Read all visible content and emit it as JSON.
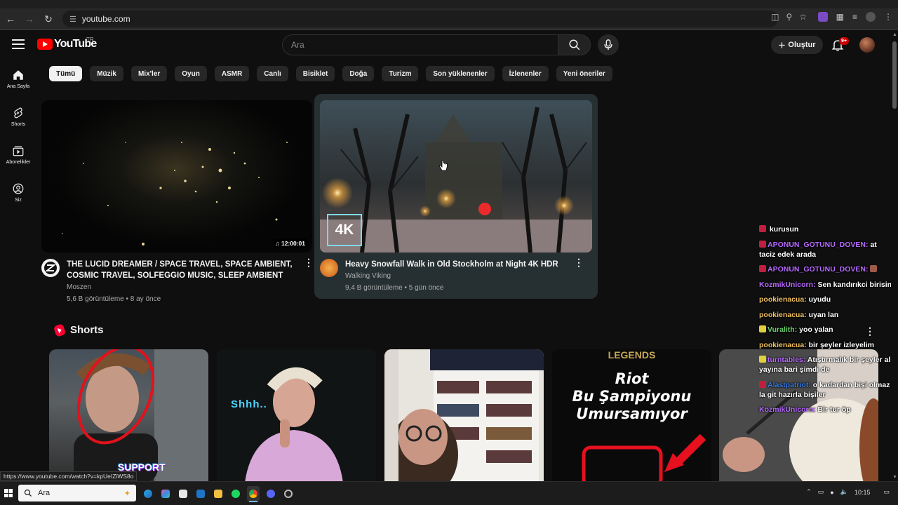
{
  "browser": {
    "url": "youtube.com",
    "url_icon": "site-settings-icon"
  },
  "masthead": {
    "logo_text": "YouTube",
    "country_code": "TR",
    "search_placeholder": "Ara",
    "create_label": "Oluştur",
    "notification_count": "9+"
  },
  "guide": [
    {
      "label": "Ana Sayfa",
      "icon": "home-icon"
    },
    {
      "label": "Shorts",
      "icon": "shorts-icon"
    },
    {
      "label": "Abonelikler",
      "icon": "subscriptions-icon"
    },
    {
      "label": "Siz",
      "icon": "you-icon"
    }
  ],
  "chips": [
    "Tümü",
    "Müzik",
    "Mix'ler",
    "Oyun",
    "ASMR",
    "Canlı",
    "Bisiklet",
    "Doğa",
    "Turizm",
    "Son yüklenenler",
    "İzlenenler",
    "Yeni öneriler"
  ],
  "videos": [
    {
      "title": "THE LUCID DREAMER / SPACE TRAVEL, SPACE AMBIENT, COSMIC TRAVEL, SOLFEGGIO MUSIC, SLEEP AMBIENT",
      "channel": "Moszen",
      "stats": "5,6 B görüntüleme • 8 ay önce",
      "duration": "12:00:01"
    },
    {
      "title": "Heavy Snowfall Walk in Old Stockholm at Night 4K HDR",
      "channel": "Walking Viking",
      "stats": "9,4 B görüntüleme • 5 gün önce",
      "badge": "4K"
    }
  ],
  "shorts": {
    "title": "Shorts",
    "items": [
      {
        "overlay": "SUPPORT"
      },
      {
        "overlay": "Shhh.."
      },
      {
        "overlay": ""
      },
      {
        "overlay_top": "LEGENDS",
        "overlay_lines": [
          "Riot",
          "Bu Şampiyonu",
          "Umursamıyor"
        ]
      },
      {
        "overlay": ""
      }
    ]
  },
  "chat": [
    {
      "user": "",
      "text": "kurusun"
    },
    {
      "user": "APONUN_GOTUNU_DOVEN:",
      "text": "at taciz edek arada"
    },
    {
      "user": "APONUN_GOTUNU_DOVEN:",
      "text": ""
    },
    {
      "user": "KozmikUnicorn:",
      "text": "Sen kandırıkci birisin"
    },
    {
      "user": "pookienacua:",
      "text": "uyudu"
    },
    {
      "user": "pookienacua:",
      "text": "uyan lan"
    },
    {
      "user": "Vuralith:",
      "text": "yoo yalan"
    },
    {
      "user": "pookienacua:",
      "text": "bir şeyler izleyelim"
    },
    {
      "user": "turntables:",
      "text": "Atıştırmalık bir şeyler al yayına bari şimdi de"
    },
    {
      "user": "Alastpatriot:",
      "text": "o kadardan bişi olmaz la git hazırla bişiler"
    },
    {
      "user": "KozmikUnicorn:",
      "text": "Bir tur öp"
    }
  ],
  "status_url": "https://www.youtube.com/watch?v=kpUeIZiWS8o",
  "taskbar": {
    "search_label": "Ara",
    "time": "10:15"
  },
  "colors": {
    "background": "#0f0f0f",
    "brand_red": "#ff0000",
    "hover_card": "#263032",
    "chat_user_purple": "#b76bff",
    "chat_user_gold": "#f0c060"
  }
}
